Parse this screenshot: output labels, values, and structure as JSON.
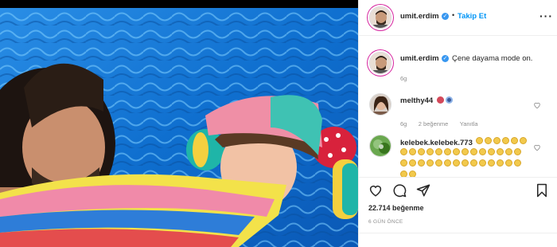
{
  "post": {
    "username": "umit.erdim",
    "follow_label": "Takip Et",
    "dot": "•",
    "more_label": "···"
  },
  "caption": {
    "username": "umit.erdim",
    "text": "Çene dayama mode on.",
    "time": "6g"
  },
  "comments": [
    {
      "username": "melthy44",
      "time": "6g",
      "likes": "2 beğenme",
      "reply_label": "Yanıtla"
    },
    {
      "username": "kelebek.kelebek.773"
    }
  ],
  "stats": {
    "likes_text": "22.714 beğenme",
    "date": "6 GÜN ÖNCE"
  },
  "icons": {
    "header_avatar": "profile-photo",
    "verified": "verified-badge-icon",
    "more": "more-options-icon",
    "like": "heart-icon",
    "comment": "comment-bubble-icon",
    "share": "paper-plane-icon",
    "save": "bookmark-icon",
    "comment_like": "small-heart-icon"
  },
  "colors": {
    "link": "#0095f6",
    "verified": "#3897f0",
    "meta": "#8e8e8e",
    "pool": "#1a7fd6"
  }
}
